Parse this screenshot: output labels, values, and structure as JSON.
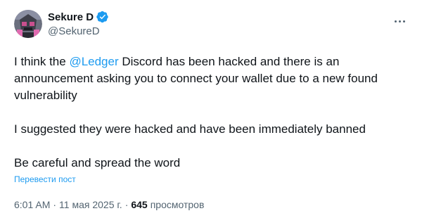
{
  "author": {
    "display_name": "Sekure D",
    "handle": "@SekureD",
    "verified": true
  },
  "tweet": {
    "line1_before": "I think the ",
    "mention": "@Ledger",
    "line1_after": " Discord has been hacked and there is an announcement asking you to connect your wallet due to a new found vulnerability",
    "paragraph2": "I suggested they were hacked and have been immediately banned",
    "paragraph3": "Be careful and spread the word"
  },
  "translate_label": "Перевести пост",
  "meta": {
    "time": "6:01 AM",
    "separator": "·",
    "date": "11 мая 2025 г.",
    "views_count": "645",
    "views_label": "просмотров"
  },
  "colors": {
    "text": "#0f1419",
    "secondary": "#536471",
    "link": "#1d9bf0",
    "verified": "#1d9bf0"
  },
  "icons": {
    "more": "more-horizontal-icon",
    "verified": "verified-badge-icon"
  }
}
